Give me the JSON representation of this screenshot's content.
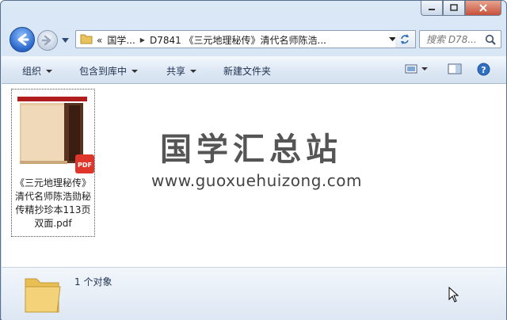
{
  "address": {
    "crumbs": [
      "«",
      "国学...",
      "D7841 《三元地理秘传》清代名师陈浩..."
    ]
  },
  "search": {
    "placeholder": "搜索 D78..."
  },
  "toolbar": {
    "organize": "组织",
    "include_library": "包含到库中",
    "share": "共享",
    "new_folder": "新建文件夹"
  },
  "files": [
    {
      "name": "《三元地理秘传》清代名师陈浩勋秘传精抄珍本113页双面.pdf",
      "type": "pdf",
      "badge": "PDF"
    }
  ],
  "watermark": {
    "title": "国学汇总站",
    "url": "www.guoxuehuizong.com"
  },
  "status": {
    "count": "1 个对象"
  },
  "colors": {
    "accent": "#2a66c9",
    "pdf_badge": "#e0352b",
    "close": "#c8513a"
  }
}
